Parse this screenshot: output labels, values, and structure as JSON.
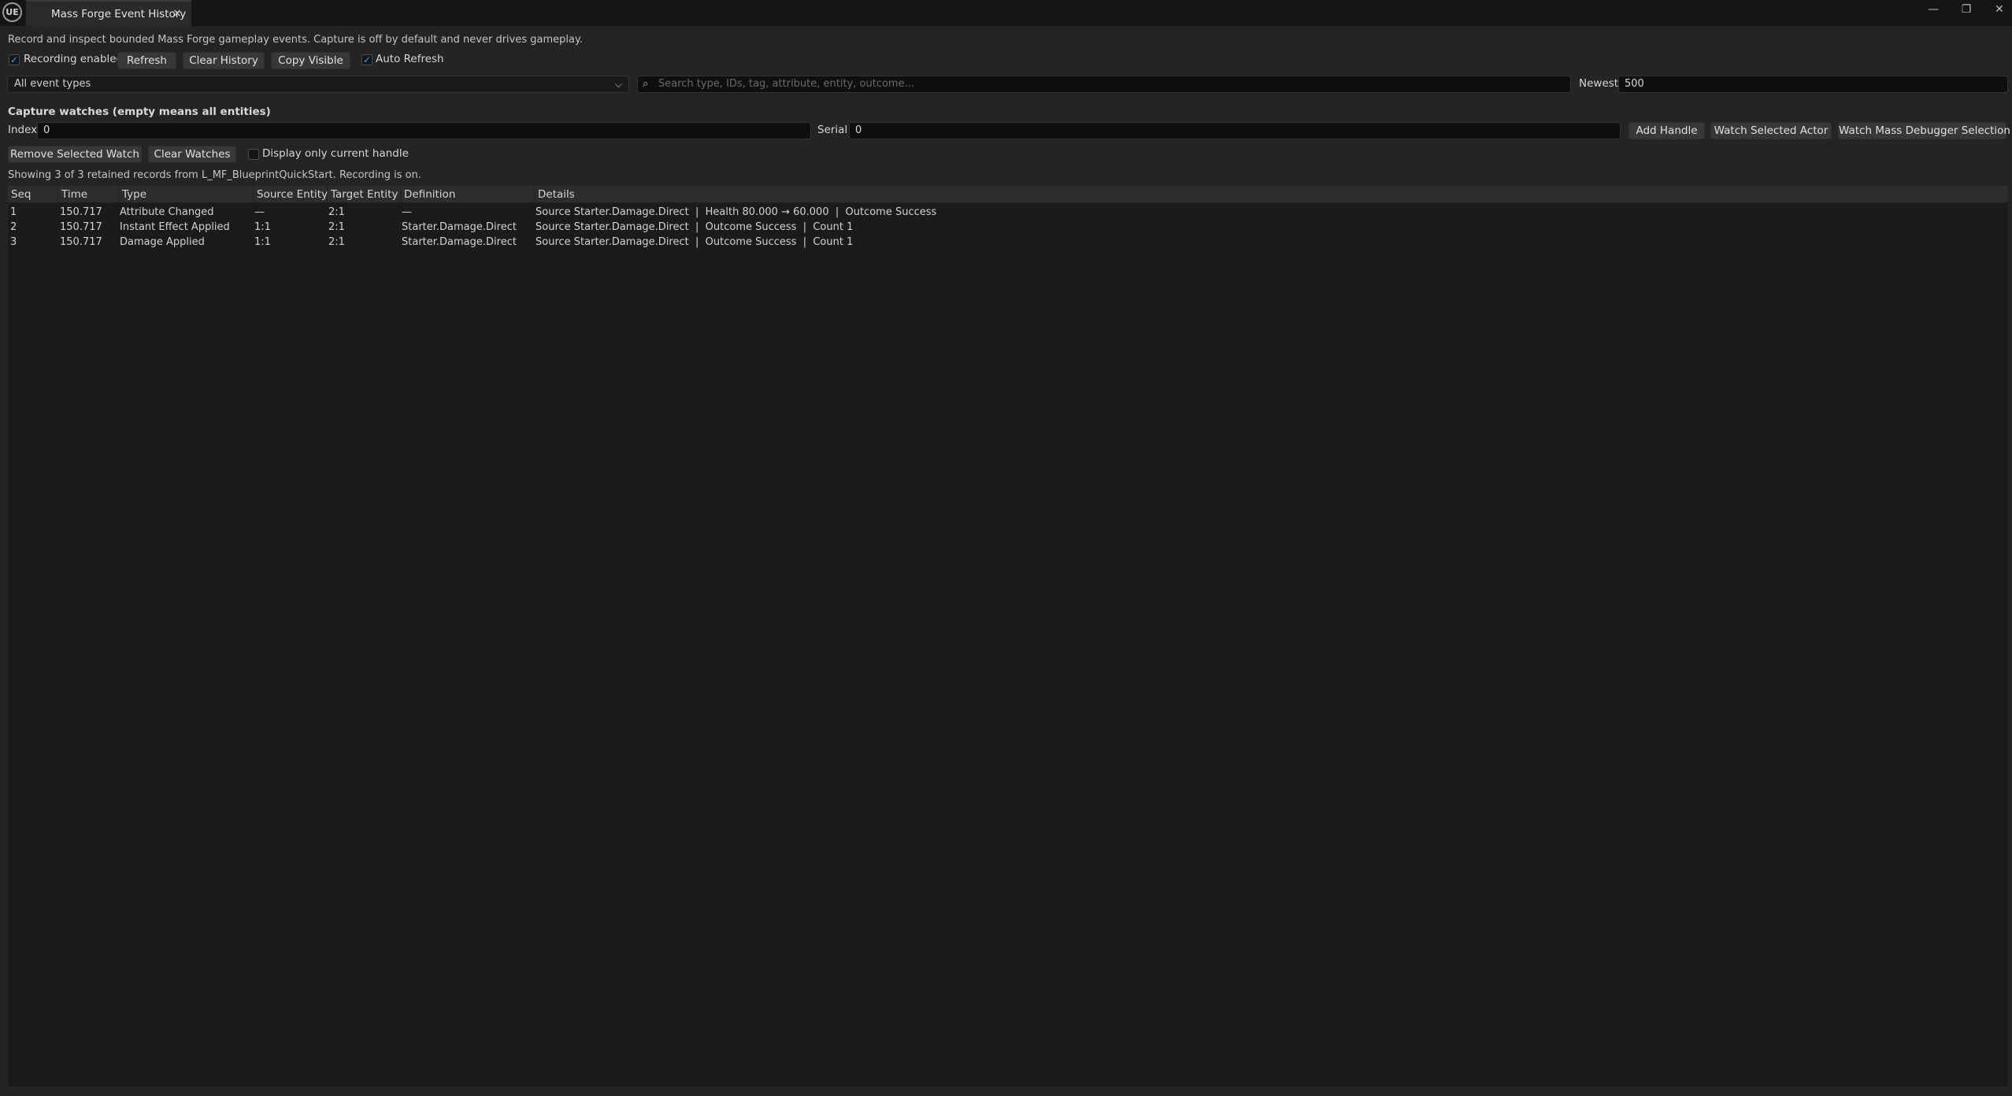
{
  "app": {
    "logo_text": "UE"
  },
  "tab": {
    "title": "Mass Forge Event History",
    "close_glyph": "×"
  },
  "window": {
    "minimize": "—",
    "restore": "❐",
    "close": "✕"
  },
  "description": "Record and inspect bounded Mass Forge gameplay events. Capture is off by default and never drives gameplay.",
  "toolbar": {
    "recording_label": "Recording enabled",
    "recording_checked": true,
    "refresh_label": "Refresh",
    "clear_history_label": "Clear History",
    "copy_visible_label": "Copy Visible",
    "auto_refresh_label": "Auto Refresh",
    "auto_refresh_checked": true
  },
  "filter": {
    "event_type_selected": "All event types",
    "search_placeholder": "Search type, IDs, tag, attribute, entity, outcome...",
    "search_value": "",
    "newest_label": "Newest",
    "newest_value": "500"
  },
  "watches": {
    "title": "Capture watches (empty means all entities)",
    "index_label": "Index",
    "index_value": "0",
    "serial_label": "Serial",
    "serial_value": "0",
    "add_handle_label": "Add Handle",
    "watch_selected_actor_label": "Watch Selected Actor",
    "watch_mass_debugger_label": "Watch Mass Debugger Selection",
    "remove_selected_label": "Remove Selected Watch",
    "clear_watches_label": "Clear Watches",
    "display_only_current_label": "Display only current handle",
    "display_only_current_checked": false
  },
  "status_text": "Showing 3 of 3 retained records from L_MF_BlueprintQuickStart. Recording is on.",
  "table": {
    "columns": [
      "Seq",
      "Time",
      "Type",
      "Source Entity",
      "Target Entity",
      "Definition",
      "Details"
    ],
    "rows": [
      [
        "1",
        "150.717",
        "Attribute Changed",
        "—",
        "2:1",
        "—",
        "Source Starter.Damage.Direct  |  Health 80.000 → 60.000  |  Outcome Success"
      ],
      [
        "2",
        "150.717",
        "Instant Effect Applied",
        "1:1",
        "2:1",
        "Starter.Damage.Direct",
        "Source Starter.Damage.Direct  |  Outcome Success  |  Count 1"
      ],
      [
        "3",
        "150.717",
        "Damage Applied",
        "1:1",
        "2:1",
        "Starter.Damage.Direct",
        "Source Starter.Damage.Direct  |  Outcome Success  |  Count 1"
      ]
    ]
  },
  "colors": {
    "accent": "#4c9be8",
    "background": "#242424",
    "table_bg": "#1b1b1b"
  }
}
